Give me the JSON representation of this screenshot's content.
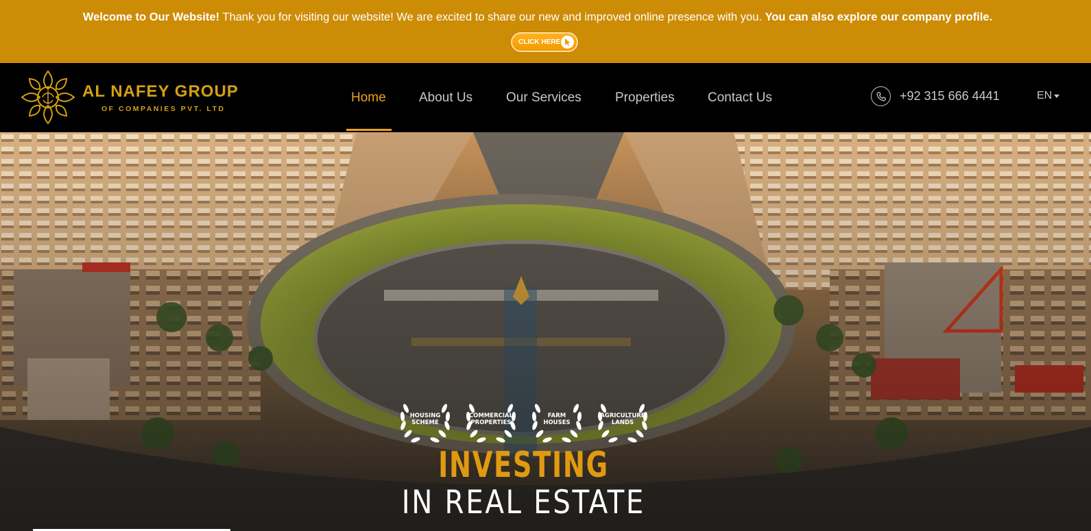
{
  "announcement": {
    "welcome": "Welcome to Our Website!",
    "message": " Thank you for visiting our website! We are excited to share our new and improved online presence with you. ",
    "profile": "You can also explore our company profile.",
    "button_label": "CLICK HERE"
  },
  "brand": {
    "name": "AL NAFEY GROUP",
    "subtitle": "OF COMPANIES PVT. LTD",
    "color": "#d4a017"
  },
  "nav": {
    "items": [
      "Home",
      "About Us",
      "Our Services",
      "Properties",
      "Contact Us"
    ],
    "active": "Home"
  },
  "contact": {
    "phone": "+92 315 666 4441",
    "phone_icon": "phone-icon"
  },
  "language": {
    "selected": "EN"
  },
  "hero": {
    "badges": [
      "HOUSING\nSCHEME",
      "COMMERCIAL\nPROPERTIES",
      "FARM\nHOUSES",
      "AGRICULTURE\nLANDS"
    ],
    "title_line1": "INVESTING",
    "title_line2": "IN REAL ESTATE"
  },
  "colors": {
    "announcement_bg": "#cd8c05",
    "accent": "#f0a020",
    "header_bg": "#000000"
  }
}
